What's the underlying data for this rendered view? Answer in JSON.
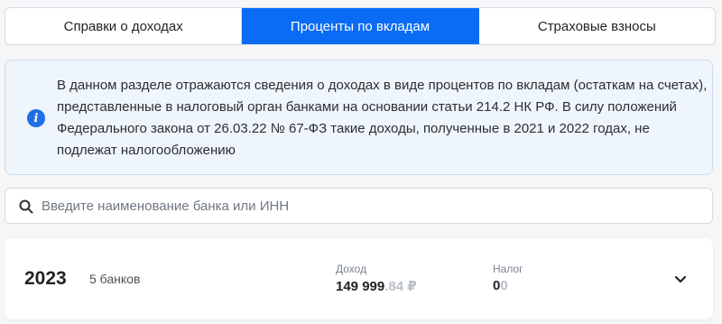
{
  "tabs": [
    {
      "label": "Справки о доходах",
      "active": false
    },
    {
      "label": "Проценты по вкладам",
      "active": true
    },
    {
      "label": "Страховые взносы",
      "active": false
    }
  ],
  "info": {
    "icon": "info-icon",
    "text": "В данном разделе отражаются сведения о доходах в виде процентов по вкладам (остаткам на счетах), представленные в налоговый орган банками на основании статьи 214.2 НК РФ. В силу положений Федерального закона от 26.03.22 № 67-ФЗ такие доходы, полученные в 2021 и 2022 годах, не подлежат налогообложению"
  },
  "search": {
    "icon": "search-icon",
    "placeholder": "Введите наименование банка или ИНН",
    "value": ""
  },
  "year_card": {
    "year": "2023",
    "banks_count": "5 банков",
    "income_label": "Доход",
    "income_int": "149 999",
    "income_frac": ".84 ₽",
    "tax_label": "Налог",
    "tax_int": "0",
    "tax_frac": "0",
    "expand_icon": "chevron-down-icon"
  },
  "colors": {
    "accent": "#0a6cf5",
    "info_bg": "#eef5fb",
    "info_icon": "#1f6fe5"
  }
}
